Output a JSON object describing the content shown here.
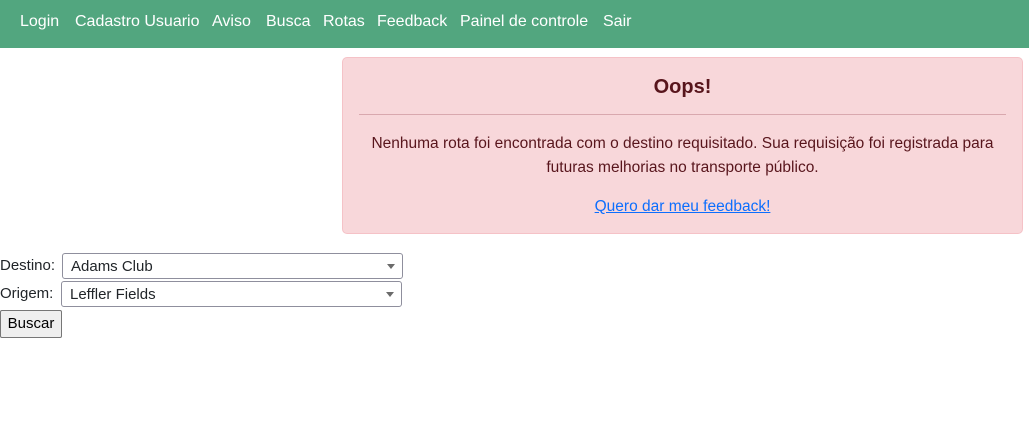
{
  "navbar": {
    "background": "#52a67f",
    "items": [
      {
        "label": "Login"
      },
      {
        "label": "Cadastro Usuario"
      },
      {
        "label": "Aviso"
      },
      {
        "label": "Busca"
      },
      {
        "label": "Rotas"
      },
      {
        "label": "Feedback"
      },
      {
        "label": "Painel de controle"
      },
      {
        "label": "Sair"
      }
    ]
  },
  "alert": {
    "title": "Oops!",
    "message": "Nenhuma rota foi encontrada com o destino requisitado. Sua requisição foi registrada para futuras melhorias no transporte público.",
    "link_text": "Quero dar meu feedback!",
    "background": "#f8d7da",
    "text_color": "#842029"
  },
  "form": {
    "destino_label": "Destino:",
    "destino_value": "Adams Club",
    "origem_label": "Origem:",
    "origem_value": "Leffler Fields",
    "submit_label": "Buscar"
  }
}
